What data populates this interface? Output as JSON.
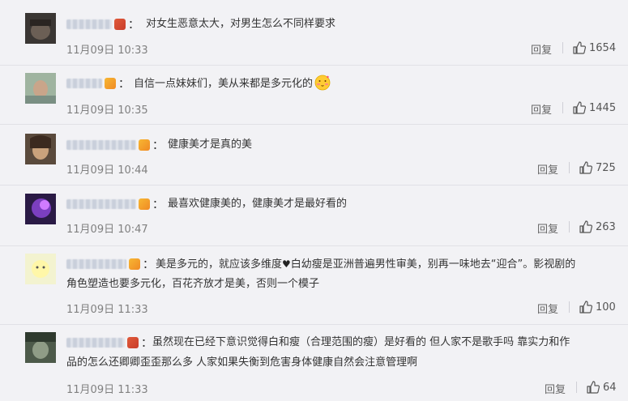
{
  "comments": [
    {
      "text": "对女生恶意太大，对男生怎么不同样要求",
      "time": "11月09日 10:33",
      "reply": "回复",
      "likes": "1654"
    },
    {
      "text": "自信一点妹妹们，美从来都是多元化的",
      "emoji": "blushing-kiss-emoji",
      "time": "11月09日 10:35",
      "reply": "回复",
      "likes": "1445"
    },
    {
      "text": "健康美才是真的美",
      "time": "11月09日 10:44",
      "reply": "回复",
      "likes": "725"
    },
    {
      "text": "最喜欢健康美的，健康美才是最好看的",
      "time": "11月09日 10:47",
      "reply": "回复",
      "likes": "263"
    },
    {
      "text_line1_a": "美是多元的，就应该多维度",
      "heart": "♥",
      "text_line1_b": "白幼瘦是亚洲普遍男性审美，别再一味地去“迎合”。影视剧的",
      "text_line2": "角色塑造也要多元化，百花齐放才是美，否则一个模子",
      "time": "11月09日 11:33",
      "reply": "回复",
      "likes": "100"
    },
    {
      "text_line1": "虽然现在已经下意识觉得白和瘦（合理范围的瘦）是好看的 但人家不是歌手吗 靠实力和作",
      "text_line2": "品的怎么还卿卿歪歪那么多 人家如果失衡到危害身体健康自然会注意管理啊",
      "time": "11月09日 11:33",
      "reply": "回复",
      "likes": "64"
    }
  ],
  "colon": "："
}
